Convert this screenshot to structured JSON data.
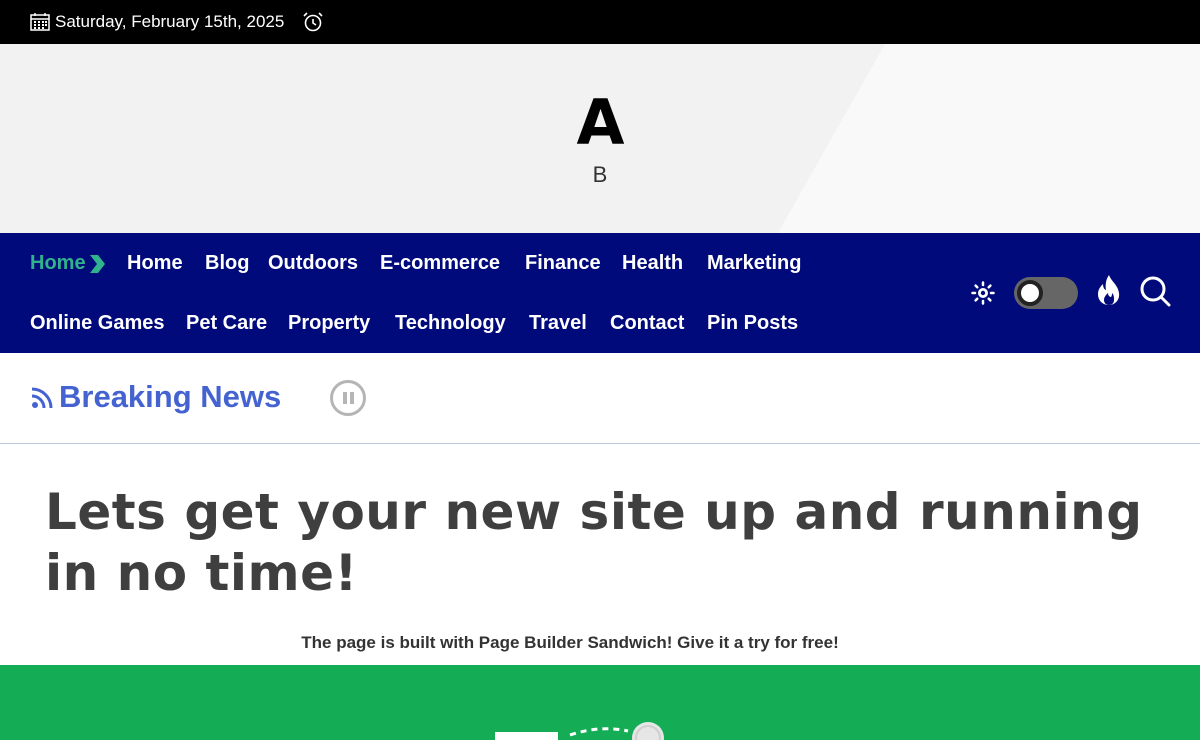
{
  "topbar": {
    "date": "Saturday, February 15th, 2025",
    "calendar_icon": "calendar-icon",
    "clock_icon": "alarm-clock-icon"
  },
  "header": {
    "site_title": "A",
    "tagline": "B"
  },
  "nav": {
    "items": [
      {
        "label": "Home",
        "active": true
      },
      {
        "label": "Home"
      },
      {
        "label": "Blog"
      },
      {
        "label": "Outdoors"
      },
      {
        "label": "E-commerce"
      },
      {
        "label": "Finance"
      },
      {
        "label": "Health"
      },
      {
        "label": "Marketing"
      },
      {
        "label": "Online Games"
      },
      {
        "label": "Pet Care"
      },
      {
        "label": "Property"
      },
      {
        "label": "Technology"
      },
      {
        "label": "Travel"
      },
      {
        "label": "Contact"
      },
      {
        "label": "Pin Posts"
      }
    ],
    "tools": [
      "sun-icon",
      "dark-mode-toggle",
      "fire-icon",
      "search-icon"
    ]
  },
  "breaking": {
    "label": "Breaking News"
  },
  "hero": {
    "title": "Lets get your new site up and running in no time!",
    "subtitle": "The page is built with Page Builder Sandwich! Give it a try for free!"
  },
  "colors": {
    "nav_bg": "#000a7a",
    "accent_green": "#30b28d",
    "breaking_blue": "#4463d0",
    "section_green": "#14ad55"
  }
}
